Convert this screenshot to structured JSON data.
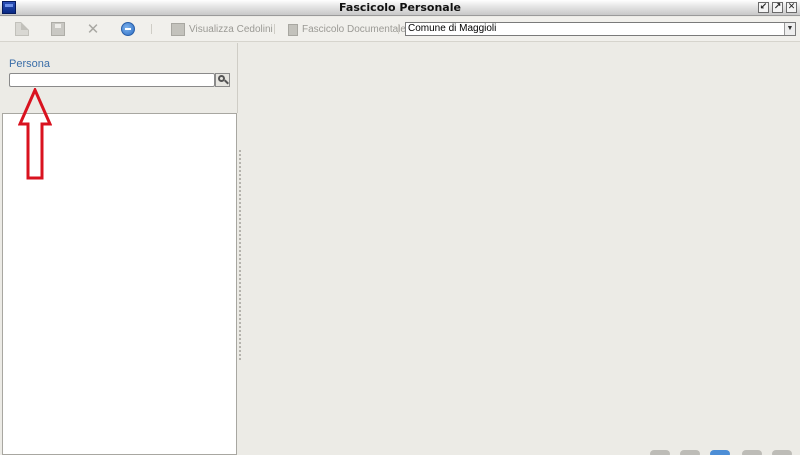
{
  "window": {
    "title": "Fascicolo Personale",
    "controls": [
      "minimize",
      "maximize",
      "close"
    ]
  },
  "toolbar": {
    "icons": [
      "new-icon",
      "save-icon",
      "delete-icon",
      "refresh-icon"
    ],
    "visualizza_cedolini_label": "Visualizza Cedolini",
    "fascicolo_documentale_label": "Fascicolo Documentale",
    "comune_select_value": "Comune di Maggioli"
  },
  "left_panel": {
    "persona_label": "Persona",
    "persona_input_value": "",
    "search_icon": "magnifier-icon"
  },
  "colors": {
    "label_blue": "#3b6ea8",
    "annotation_red": "#d9121f",
    "background": "#ecebe6"
  }
}
